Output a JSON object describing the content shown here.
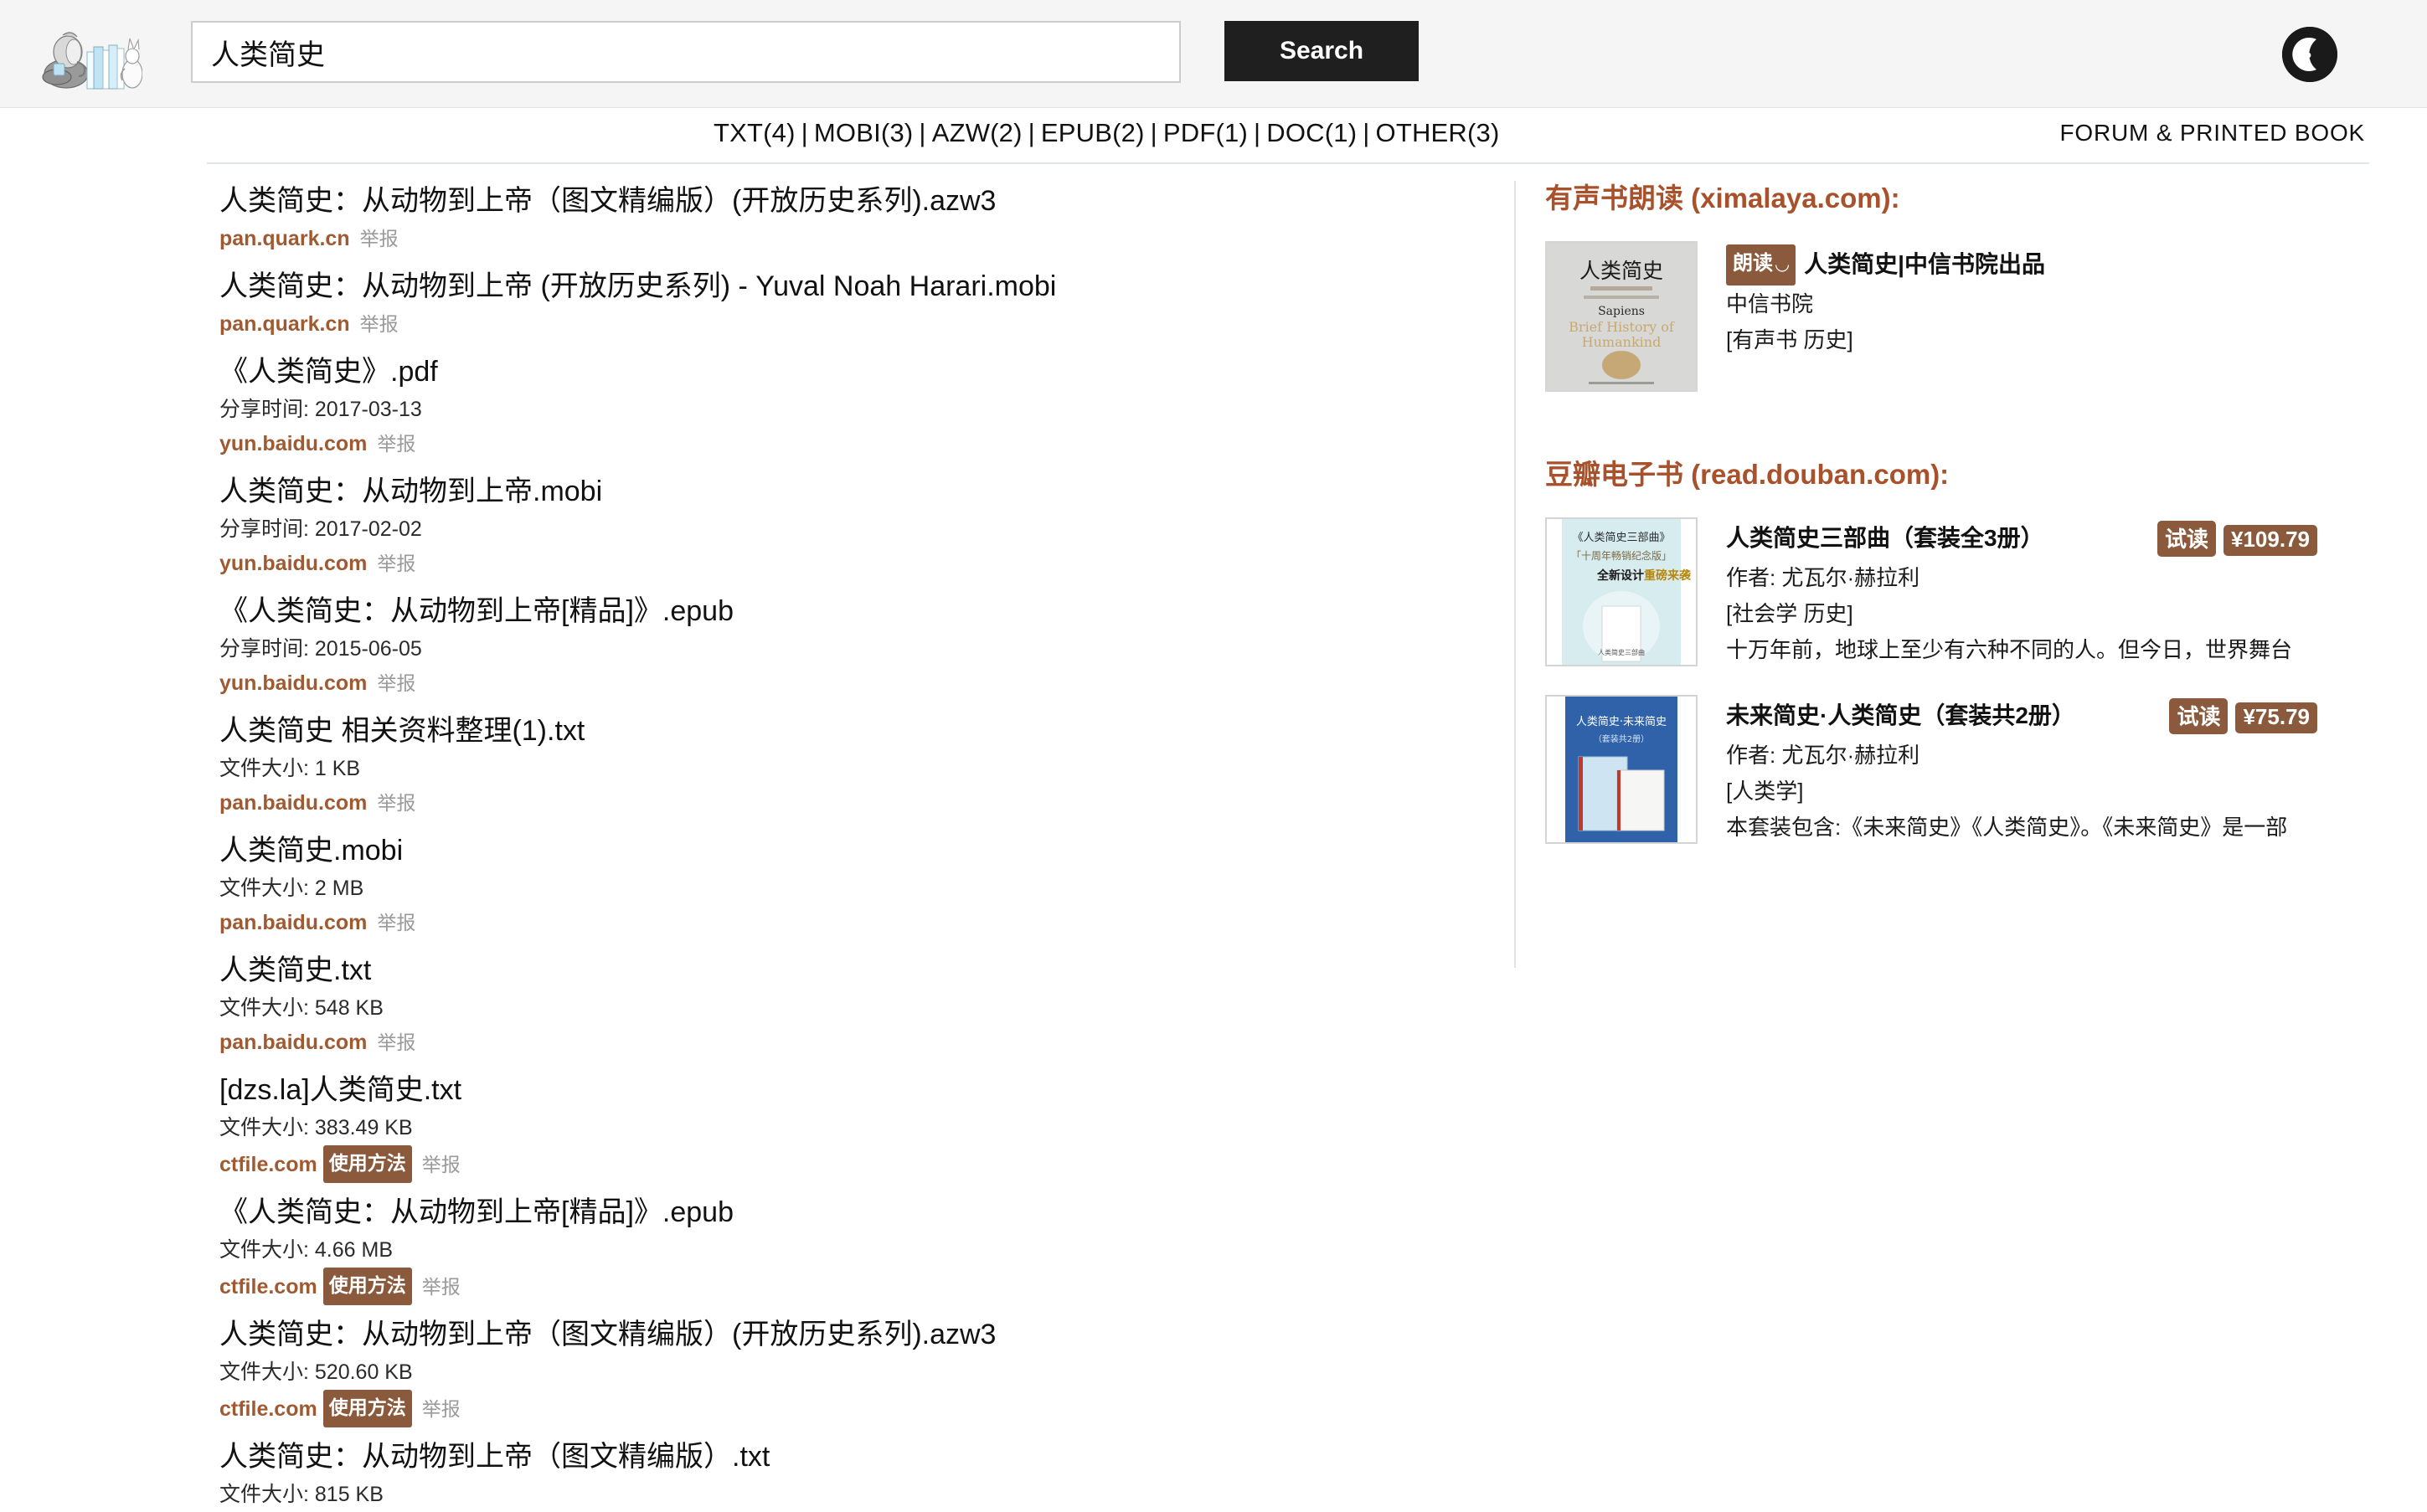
{
  "header": {
    "logo_alt": "elephant-reading-books-logo",
    "search_value": "人类简史",
    "search_placeholder": "",
    "search_button": "Search",
    "darkmode_icon": "moon-icon"
  },
  "tabbar": {
    "filters": [
      {
        "label": "TXT(4)"
      },
      {
        "label": "MOBI(3)"
      },
      {
        "label": "AZW(2)"
      },
      {
        "label": "EPUB(2)"
      },
      {
        "label": "PDF(1)"
      },
      {
        "label": "DOC(1)"
      },
      {
        "label": "OTHER(3)"
      }
    ],
    "separator": "|",
    "forum_link": "FORUM & PRINTED BOOK"
  },
  "results": [
    {
      "title": "人类简史：从动物到上帝（图文精编版）(开放历史系列).azw3",
      "meta": "",
      "source": "pan.quark.cn",
      "howto": "",
      "report": "举报"
    },
    {
      "title": "人类简史：从动物到上帝 (开放历史系列) - Yuval Noah Harari.mobi",
      "meta": "",
      "source": "pan.quark.cn",
      "howto": "",
      "report": "举报"
    },
    {
      "title": "《人类简史》.pdf",
      "meta": "分享时间: 2017-03-13",
      "source": "yun.baidu.com",
      "howto": "",
      "report": "举报"
    },
    {
      "title": "人类简史：从动物到上帝.mobi",
      "meta": "分享时间: 2017-02-02",
      "source": "yun.baidu.com",
      "howto": "",
      "report": "举报"
    },
    {
      "title": "《人类简史：从动物到上帝[精品]》.epub",
      "meta": "分享时间: 2015-06-05",
      "source": "yun.baidu.com",
      "howto": "",
      "report": "举报"
    },
    {
      "title": "人类简史 相关资料整理(1).txt",
      "meta": "文件大小: 1 KB",
      "source": "pan.baidu.com",
      "howto": "",
      "report": "举报"
    },
    {
      "title": "人类简史.mobi",
      "meta": "文件大小: 2 MB",
      "source": "pan.baidu.com",
      "howto": "",
      "report": "举报"
    },
    {
      "title": "人类简史.txt",
      "meta": "文件大小: 548 KB",
      "source": "pan.baidu.com",
      "howto": "",
      "report": "举报"
    },
    {
      "title": "[dzs.la]人类简史.txt",
      "meta": "文件大小: 383.49 KB",
      "source": "ctfile.com",
      "howto": "使用方法",
      "report": "举报"
    },
    {
      "title": "《人类简史：从动物到上帝[精品]》.epub",
      "meta": "文件大小: 4.66 MB",
      "source": "ctfile.com",
      "howto": "使用方法",
      "report": "举报"
    },
    {
      "title": "人类简史：从动物到上帝（图文精编版）(开放历史系列).azw3",
      "meta": "文件大小: 520.60 KB",
      "source": "ctfile.com",
      "howto": "使用方法",
      "report": "举报"
    },
    {
      "title": "人类简史：从动物到上帝（图文精编版）.txt",
      "meta": "文件大小: 815 KB",
      "source": "",
      "howto": "",
      "report": ""
    }
  ],
  "sidebar": {
    "audiobook": {
      "title": "有声书朗读 (ximalaya.com):",
      "items": [
        {
          "badge": "朗读",
          "badge_icon": "headphone-icon",
          "title": "人类简史|中信书院出品",
          "publisher": "中信书院",
          "tags": "[有声书 历史]",
          "cover_alt": "renlei-jianshi-audiobook-cover"
        }
      ]
    },
    "ebook": {
      "title": "豆瓣电子书 (read.douban.com):",
      "items": [
        {
          "title": "人类简史三部曲（套装全3册）",
          "author": "作者: 尤瓦尔·赫拉利",
          "tags": "[社会学 历史]",
          "description": "十万年前，地球上至少有六种不同的人。但今日，世界舞台",
          "trial": "试读",
          "price": "¥109.79",
          "cover_alt": "renlei-jianshi-trilogy-cover"
        },
        {
          "title": "未来简史·人类简史（套装共2册）",
          "author": "作者: 尤瓦尔·赫拉利",
          "tags": "[人类学]",
          "description": "本套装包含:《未来简史》《人类简史》。《未来简史》是一部",
          "trial": "试读",
          "price": "¥75.79",
          "cover_alt": "weilai-renlei-jianshi-cover"
        }
      ]
    }
  },
  "colors": {
    "accent_brown": "#a8512a",
    "link_brown": "#a05a32",
    "badge_brown": "#8b5a3c",
    "header_bg": "#f5f5f5",
    "button_dark": "#1f1f1f"
  }
}
